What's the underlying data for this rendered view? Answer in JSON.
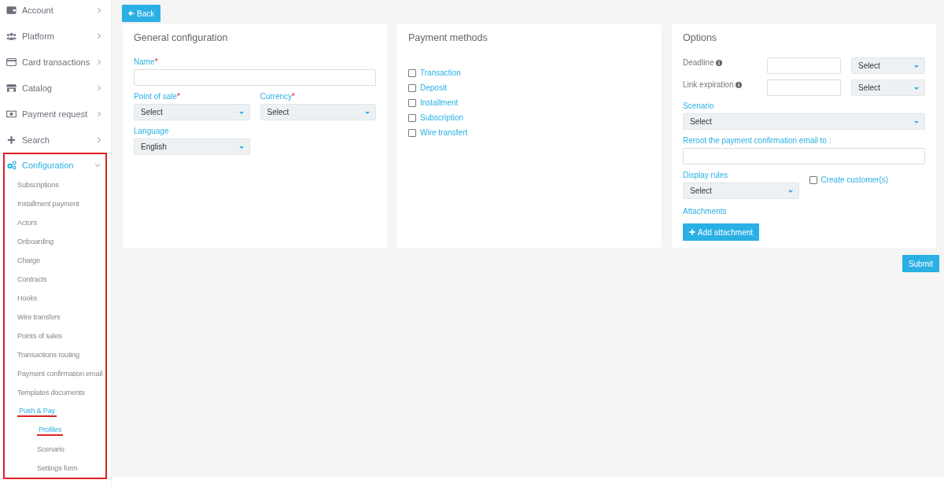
{
  "sidebar": {
    "items": [
      {
        "label": "Account",
        "expanded": false,
        "highlighted": false
      },
      {
        "label": "Platform",
        "expanded": false,
        "highlighted": false
      },
      {
        "label": "Card transactions",
        "expanded": false,
        "highlighted": false
      },
      {
        "label": "Catalog",
        "expanded": false,
        "highlighted": false
      },
      {
        "label": "Payment request",
        "expanded": false,
        "highlighted": false
      },
      {
        "label": "Search",
        "expanded": false,
        "highlighted": false
      },
      {
        "label": "Configuration",
        "expanded": true,
        "highlighted": true,
        "children": [
          {
            "label": "Subscriptions",
            "selected": false,
            "underlined": false
          },
          {
            "label": "Installment payment",
            "selected": false,
            "underlined": false
          },
          {
            "label": "Actors",
            "selected": false,
            "underlined": false
          },
          {
            "label": "Onboarding",
            "selected": false,
            "underlined": false
          },
          {
            "label": "Charge",
            "selected": false,
            "underlined": false
          },
          {
            "label": "Contracts",
            "selected": false,
            "underlined": false
          },
          {
            "label": "Hooks",
            "selected": false,
            "underlined": false
          },
          {
            "label": "Wire transfers",
            "selected": false,
            "underlined": false
          },
          {
            "label": "Points of sales",
            "selected": false,
            "underlined": false
          },
          {
            "label": "Transactions routing",
            "selected": false,
            "underlined": false
          },
          {
            "label": "Payment confirmation email",
            "selected": false,
            "underlined": false
          },
          {
            "label": "Templates documents",
            "selected": false,
            "underlined": false
          },
          {
            "label": "Push & Pay",
            "selected": true,
            "underlined": true,
            "children": [
              {
                "label": "Profiles",
                "selected": true,
                "underlined": true
              },
              {
                "label": "Scenario",
                "selected": false,
                "underlined": false
              },
              {
                "label": "Settings form",
                "selected": false,
                "underlined": false
              }
            ]
          }
        ]
      }
    ]
  },
  "back_button": "Back",
  "general": {
    "title": "General configuration",
    "name": {
      "label": "Name",
      "required_mark": "*"
    },
    "point_of_sale": {
      "label": "Point of sale",
      "required_mark": "*",
      "value": "Select"
    },
    "currency": {
      "label": "Currency",
      "required_mark": "*",
      "value": "Select"
    },
    "language": {
      "label": "Language",
      "value": "English"
    }
  },
  "payment_methods": {
    "title": "Payment methods",
    "items": [
      {
        "label": "Transaction",
        "checked": false
      },
      {
        "label": "Deposit",
        "checked": false
      },
      {
        "label": "Installment",
        "checked": false
      },
      {
        "label": "Subscription",
        "checked": false
      },
      {
        "label": "Wire transfert",
        "checked": false
      }
    ]
  },
  "options": {
    "title": "Options",
    "timers": [
      {
        "label": "Deadline",
        "unit": "Select"
      },
      {
        "label": "Link expiration",
        "unit": "Select"
      }
    ],
    "scenario": {
      "label": "Scenario",
      "value": "Select"
    },
    "reroute": {
      "label": "Reroot the payment confirmation email to :"
    },
    "display_rules": {
      "label": "Display rules",
      "value": "Select"
    },
    "create_customers": {
      "label": "Create customer(s)",
      "checked": false
    },
    "attachments": {
      "label": "Attachments",
      "button": "Add attachment"
    }
  },
  "submit_button": "Submit"
}
